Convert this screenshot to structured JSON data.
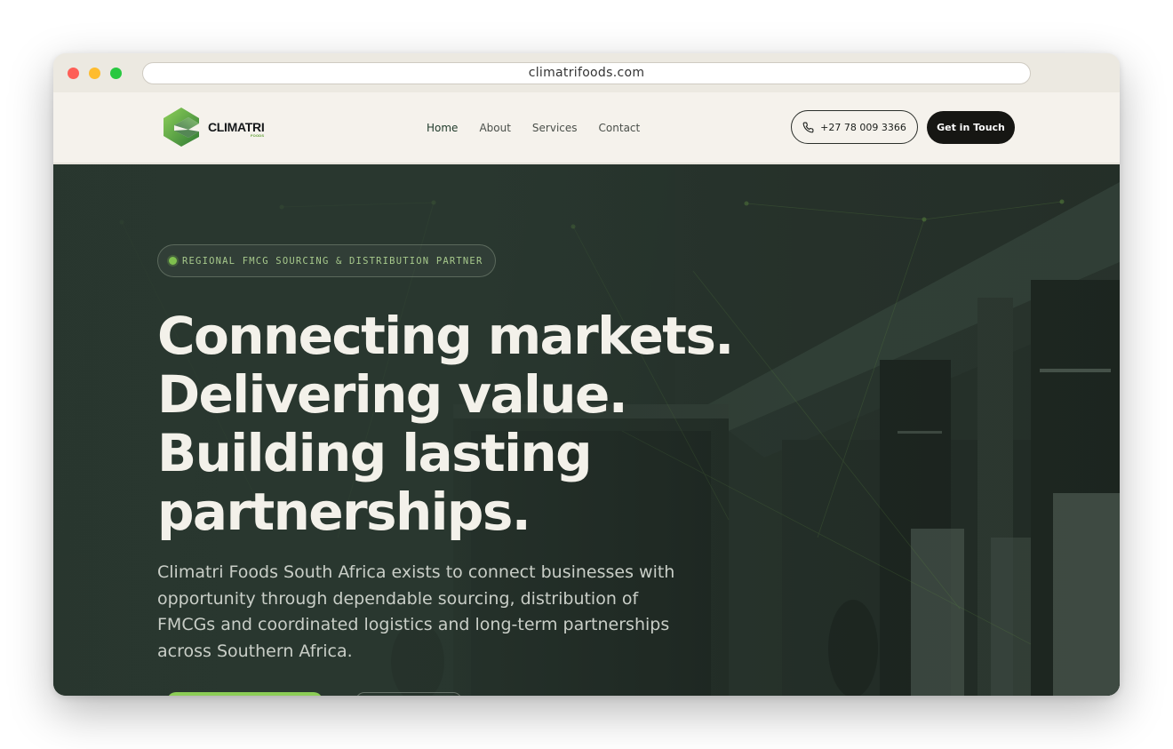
{
  "browser": {
    "url": "climatrifoods.com"
  },
  "brand": {
    "name": "CLIMATRI",
    "sub": "FOODS",
    "accent": "#7fbf4e",
    "dark": "#161613"
  },
  "nav": {
    "links": [
      "Home",
      "About",
      "Services",
      "Contact"
    ],
    "active": "Home",
    "phone": "+27 78 009 3366",
    "cta": "Get in Touch"
  },
  "hero": {
    "badge": "REGIONAL FMCG SOURCING & DISTRIBUTION PARTNER",
    "headline": [
      "Connecting markets.",
      "Delivering value.",
      "Building lasting",
      "partnerships."
    ],
    "lede": "Climatri Foods South Africa exists to connect businesses with opportunity through dependable sourcing, distribution of FMCGs and coordinated logistics and long-term partnerships across Southern Africa."
  },
  "icons": {
    "phone": "phone-icon",
    "logo": "climatri-logo-icon"
  }
}
